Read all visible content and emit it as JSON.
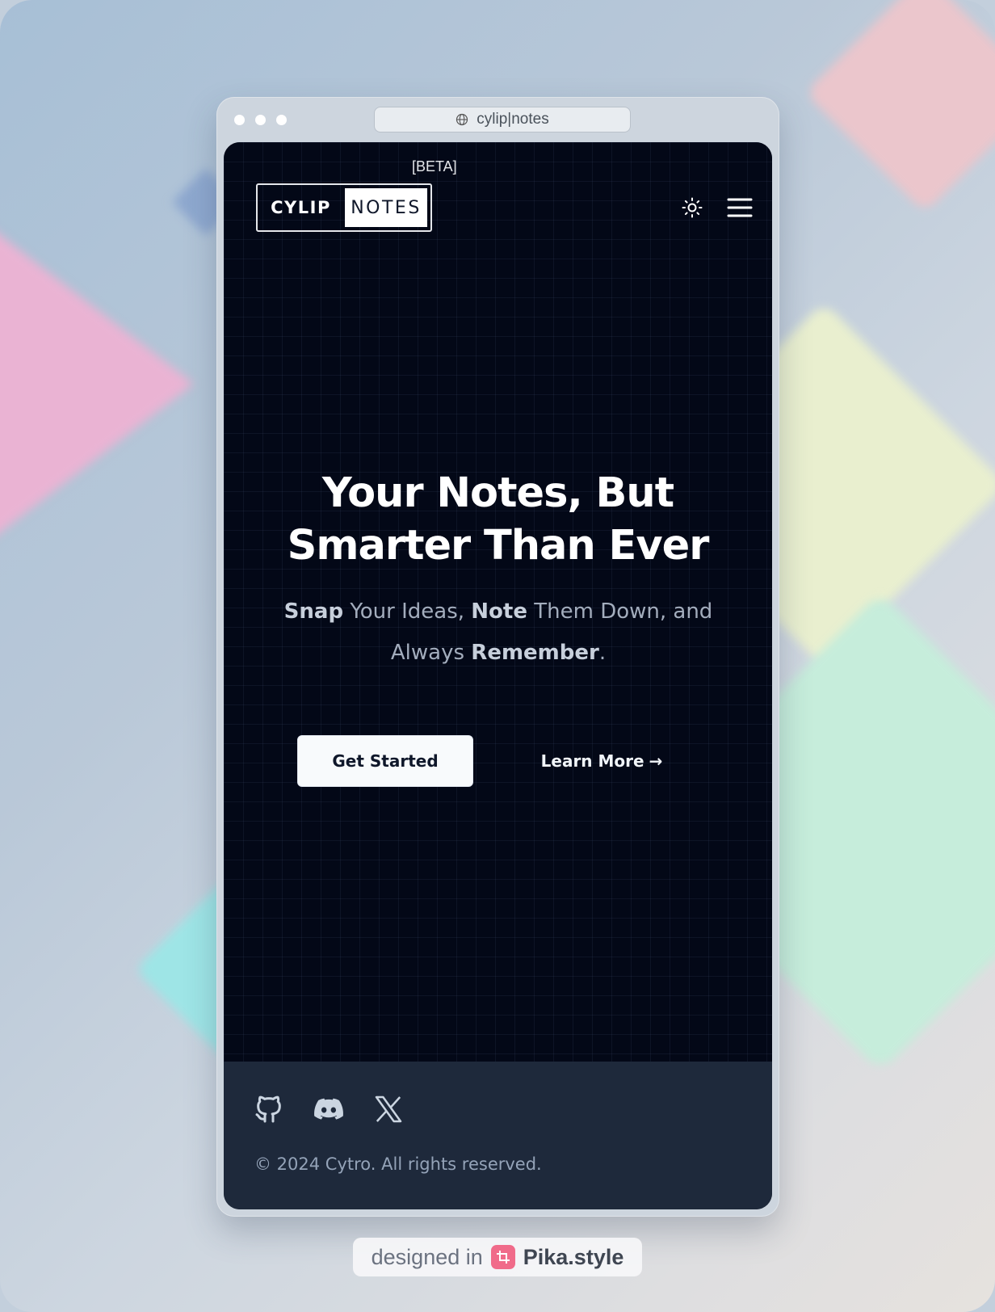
{
  "browser": {
    "url": "cylip|notes"
  },
  "header": {
    "beta_label": "[BETA]",
    "logo_left": "CYLIP",
    "logo_right": "NOTES",
    "theme_toggle_icon": "sun-icon",
    "menu_icon": "hamburger-menu-icon"
  },
  "hero": {
    "headline_line1": "Your Notes, But",
    "headline_line2": "Smarter Than Ever",
    "sub_snap": "Snap",
    "sub_part1": " Your Ideas, ",
    "sub_note": "Note",
    "sub_part2": " Them Down, and Always ",
    "sub_remember": "Remember",
    "sub_end": ".",
    "cta_primary": "Get Started",
    "cta_secondary": "Learn More",
    "cta_secondary_arrow": "→"
  },
  "footer": {
    "social": [
      {
        "icon": "github-icon"
      },
      {
        "icon": "discord-icon"
      },
      {
        "icon": "x-twitter-icon"
      }
    ],
    "copyright": "© 2024 Cytro. All rights reserved."
  },
  "badge": {
    "prefix": "designed in",
    "brand": "Pika.style"
  },
  "colors": {
    "screen_bg": "#030817",
    "footer_bg": "#1e293b",
    "primary_button_bg": "#f8fafc",
    "headline": "#ffffff",
    "subtext": "#a3adbd"
  }
}
